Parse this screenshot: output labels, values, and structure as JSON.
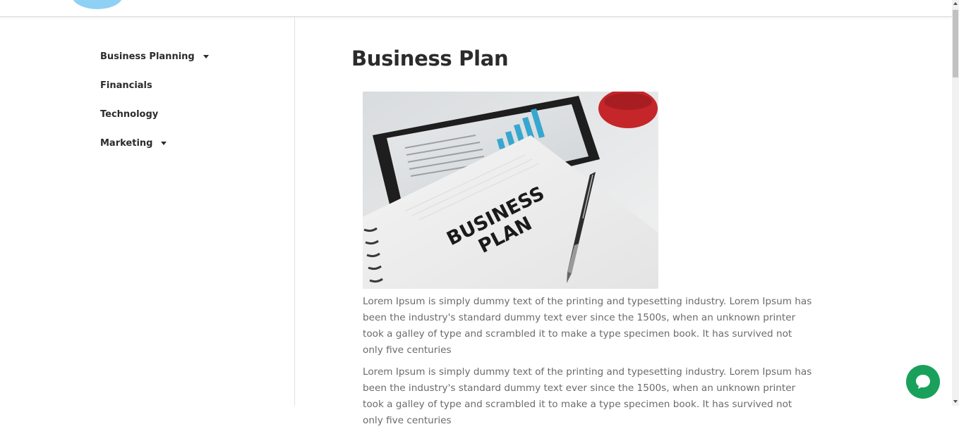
{
  "sidebar": {
    "items": [
      {
        "label": "Business Planning",
        "has_dropdown": true
      },
      {
        "label": "Financials",
        "has_dropdown": false
      },
      {
        "label": "Technology",
        "has_dropdown": false
      },
      {
        "label": "Marketing",
        "has_dropdown": true
      }
    ]
  },
  "main": {
    "title": "Business Plan",
    "image": {
      "text_line1": "BUSINESS",
      "text_line2": "PLAN"
    },
    "paragraphs": [
      "Lorem Ipsum is simply dummy text of the printing and typesetting industry. Lorem Ipsum has been the industry's standard dummy text ever since the 1500s, when an unknown printer took a galley of type and scrambled it to make a type specimen book. It has survived not only five centuries",
      "Lorem Ipsum is simply dummy text of the printing and typesetting industry. Lorem Ipsum has been the industry's standard dummy text ever since the 1500s, when an unknown printer took a galley of type and scrambled it to make a type specimen book. It has survived not only five centuries"
    ]
  },
  "icons": {
    "logo": "logo-icon",
    "caret": "caret-down-icon",
    "chat": "chat-bubble-icon"
  },
  "colors": {
    "accent_chat": "#19a15b",
    "logo": "#8fd0f5",
    "text_dark": "#2b2b2b",
    "text_body": "#6b6b6b"
  }
}
